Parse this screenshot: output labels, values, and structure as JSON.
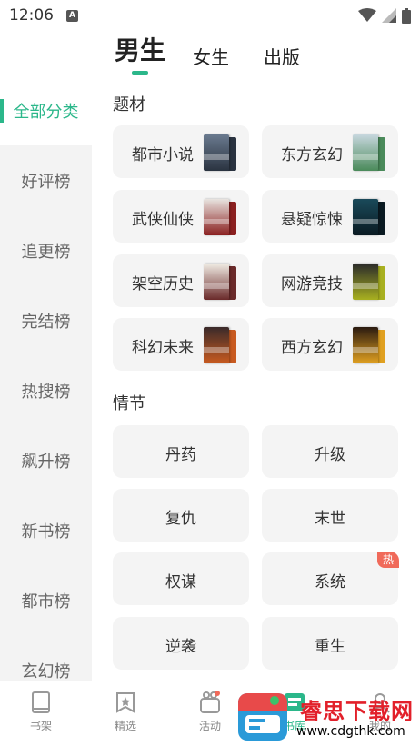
{
  "status_bar": {
    "time": "12:06",
    "notif_icon": "a-box-icon"
  },
  "top_tabs": [
    "男生",
    "女生",
    "出版"
  ],
  "sidebar": {
    "items": [
      "全部分类",
      "好评榜",
      "追更榜",
      "完结榜",
      "热搜榜",
      "飙升榜",
      "新书榜",
      "都市榜",
      "玄幻榜"
    ],
    "active_index": 0
  },
  "sections": {
    "theme": {
      "title": "题材",
      "items": [
        {
          "label": "都市小说",
          "cover": [
            "#6a7a8f",
            "#2a3340"
          ]
        },
        {
          "label": "东方玄幻",
          "cover": [
            "#c7d7de",
            "#4a8a5a"
          ]
        },
        {
          "label": "武侠仙侠",
          "cover": [
            "#e8e4e0",
            "#8a2020"
          ]
        },
        {
          "label": "悬疑惊悚",
          "cover": [
            "#1a4a5a",
            "#0a1a22"
          ]
        },
        {
          "label": "架空历史",
          "cover": [
            "#f0ece4",
            "#6a2a2a"
          ]
        },
        {
          "label": "网游竞技",
          "cover": [
            "#2a2a2a",
            "#a8b020"
          ]
        },
        {
          "label": "科幻未来",
          "cover": [
            "#3a2a2a",
            "#c85a20"
          ]
        },
        {
          "label": "西方玄幻",
          "cover": [
            "#2a1a10",
            "#e0a020"
          ]
        }
      ]
    },
    "plot": {
      "title": "情节",
      "items": [
        {
          "label": "丹药",
          "hot": ""
        },
        {
          "label": "升级",
          "hot": ""
        },
        {
          "label": "复仇",
          "hot": ""
        },
        {
          "label": "末世",
          "hot": ""
        },
        {
          "label": "权谋",
          "hot": ""
        },
        {
          "label": "系统",
          "hot": "热"
        },
        {
          "label": "逆袭",
          "hot": ""
        },
        {
          "label": "重生",
          "hot": ""
        }
      ]
    }
  },
  "bottom_nav": [
    {
      "label": "书架",
      "icon": "bookshelf-icon"
    },
    {
      "label": "精选",
      "icon": "featured-icon"
    },
    {
      "label": "活动",
      "icon": "gift-icon"
    },
    {
      "label": "书库",
      "icon": "library-icon"
    },
    {
      "label": "我的",
      "icon": "profile-icon"
    }
  ],
  "watermark": {
    "title": "睿思下载网",
    "url": "www.cdgthk.com"
  },
  "colors": {
    "accent": "#2bb78a",
    "hot": "#f06a5a",
    "watermark_red": "#e2202a"
  }
}
